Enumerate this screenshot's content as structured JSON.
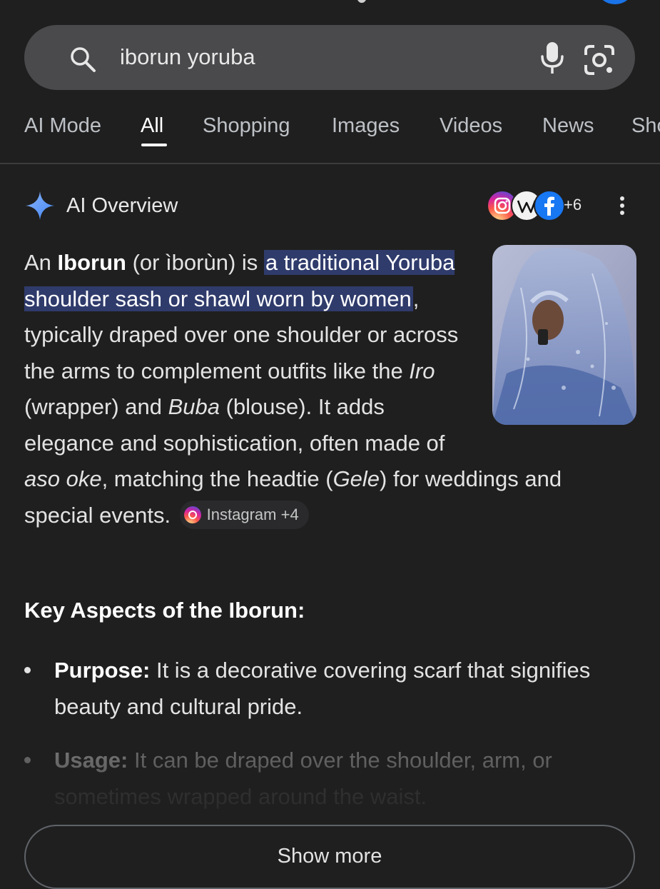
{
  "search": {
    "query": "iborun yoruba"
  },
  "tabs": [
    {
      "label": "AI Mode"
    },
    {
      "label": "All"
    },
    {
      "label": "Shopping"
    },
    {
      "label": "Images"
    },
    {
      "label": "Videos"
    },
    {
      "label": "News"
    },
    {
      "label": "Sho"
    }
  ],
  "active_tab": "All",
  "ai_overview": {
    "title": "AI Overview",
    "source_count": "+6",
    "sources": [
      "instagram-icon",
      "wikipedia-icon",
      "facebook-icon"
    ],
    "paragraph": {
      "p1": "An ",
      "term": "Iborun",
      "p2": " (or ìborùn) is ",
      "highlight": "a traditional Yoruba shoulder sash or shawl worn by women",
      "p3": ", typically draped over one shoulder or across the arms to complement outfits like the ",
      "iro": "Iro",
      "p4": " (wrapper) and ",
      "buba": "Buba",
      "p5": " (blouse). It adds elegance and sophistication, often made of ",
      "aso_oke": "aso oke",
      "p6": ", matching the headtie (",
      "gele": "Gele",
      "p7": ") for weddings and special events. "
    },
    "citation_chip": "Instagram +4",
    "key_aspects_title": "Key Aspects of the Iborun:",
    "bullets": [
      {
        "label": "Purpose:",
        "text": " It is a decorative covering scarf that signifies beauty and cultural pride."
      },
      {
        "label": "Usage:",
        "text": " It can be draped over the shoulder, arm, or",
        "faded_text": "sometimes wrapped around the waist."
      }
    ],
    "show_more_label": "Show more"
  },
  "colors": {
    "background": "#1f1f1f",
    "search_bar": "#4a4a4d",
    "highlight": "#2f3b6b",
    "accent_blue": "#1a73e8"
  }
}
